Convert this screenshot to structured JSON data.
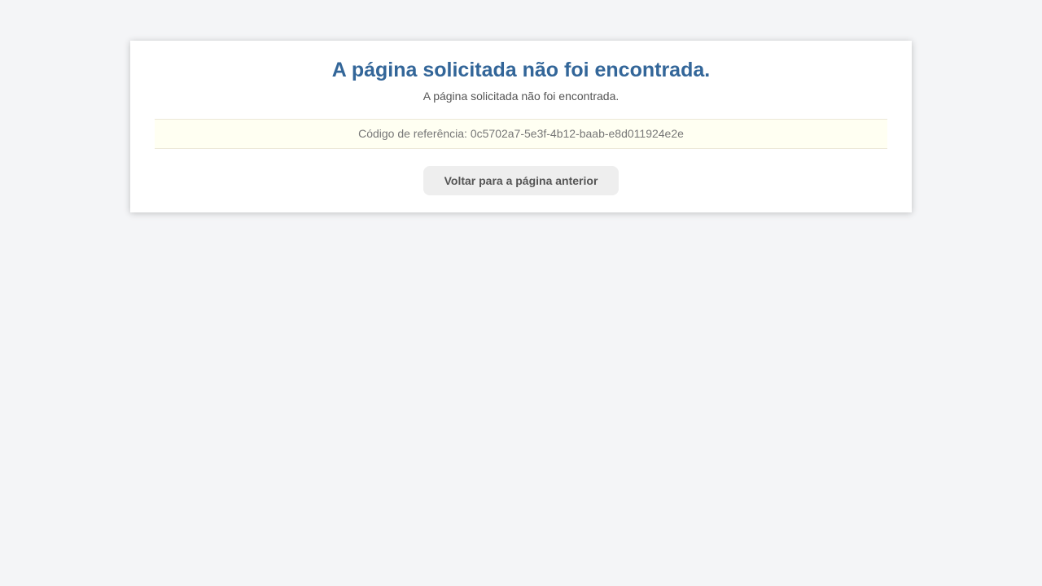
{
  "error": {
    "title": "A página solicitada não foi encontrada.",
    "message": "A página solicitada não foi encontrada.",
    "reference_label": "Código de referência: 0c5702a7-5e3f-4b12-baab-e8d011924e2e",
    "back_button_label": "Voltar para a página anterior"
  },
  "colors": {
    "title": "#336699",
    "background": "#f4f5f7",
    "reference_background": "#fffff2"
  }
}
